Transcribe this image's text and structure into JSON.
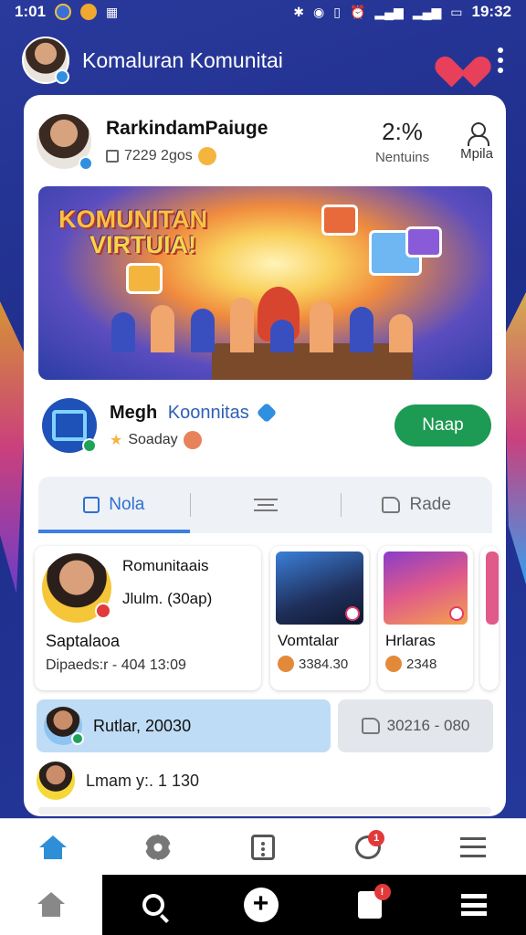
{
  "status_bar": {
    "time_left": "1:01",
    "time_right": "19:32"
  },
  "app_header": {
    "title": "Komaluran Komunitai"
  },
  "profile": {
    "name": "RarkindamPaiuge",
    "subline": "7229 2gos",
    "stat_value": "2:%",
    "stat_label": "Nentuins",
    "button_label": "Mpila"
  },
  "banner": {
    "title_line1": "KOMUNITAN",
    "title_line2": "VIRTUIA!"
  },
  "group": {
    "name_primary": "Megh",
    "name_secondary": "Koonnitas",
    "subline": "Soaday",
    "join_label": "Naap"
  },
  "tabs": [
    {
      "label": "Nola",
      "active": true
    },
    {
      "label": "",
      "active": false
    },
    {
      "label": "Rade",
      "active": false
    }
  ],
  "content_cards": {
    "main": {
      "title": "Romunitaais",
      "title2": "Jlulm. (30ap)",
      "name": "Saptalaoa",
      "meta": "Dipaeds:r   -   404 13:09"
    },
    "card_a": {
      "title": "Vomtalar",
      "meta": "3384.30"
    },
    "card_b": {
      "title": "Hrlaras",
      "meta": "2348"
    }
  },
  "list_items": {
    "item1": "Rutlar, 20030",
    "item1_right": "30216 - 080",
    "item2": "Lmam y:. 1 130"
  },
  "nav": {
    "chat_badge": "1",
    "doc_badge": "!"
  },
  "colors": {
    "accent_blue": "#2e6fd0",
    "join_green": "#1d9a53",
    "background": "#2a3a9c"
  }
}
